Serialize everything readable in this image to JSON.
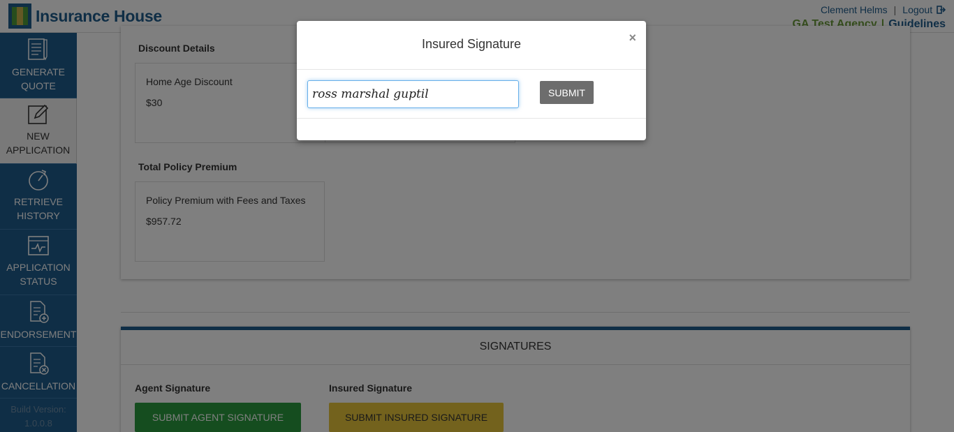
{
  "header": {
    "brand": "Insurance House",
    "user_name": "Clement Helms",
    "logout_label": "Logout",
    "agency": "GA Test Agency",
    "guidelines": "Guidelines"
  },
  "sidebar": {
    "items": [
      {
        "line1": "GENERATE",
        "line2": "QUOTE",
        "icon": "document-list-icon"
      },
      {
        "line1": "NEW",
        "line2": "APPLICATION",
        "icon": "edit-icon"
      },
      {
        "line1": "RETRIEVE",
        "line2": "HISTORY",
        "icon": "history-icon"
      },
      {
        "line1": "APPLICATION",
        "line2": "STATUS",
        "icon": "activity-icon"
      },
      {
        "line1": "ENDORSEMENT",
        "icon": "document-add-icon"
      },
      {
        "line1": "CANCELLATION",
        "icon": "document-cancel-icon"
      }
    ],
    "build_label": "Build Version:",
    "build_version": "1.0.0.8"
  },
  "discount": {
    "title": "Discount Details",
    "label": "Home Age Discount",
    "value": "$30"
  },
  "premium": {
    "title": "Total Policy Premium",
    "label": "Policy Premium with Fees and Taxes",
    "value": "$957.72"
  },
  "signatures": {
    "title": "SIGNATURES",
    "agent_label": "Agent Signature",
    "agent_button": "SUBMIT AGENT SIGNATURE",
    "insured_label": "Insured Signature",
    "insured_button": "SUBMIT INSURED SIGNATURE"
  },
  "modal": {
    "title": "Insured Signature",
    "close": "×",
    "input_value": "ross marshal guptil",
    "submit": "SUBMIT"
  },
  "colors": {
    "brand_blue": "#1f5c8c",
    "brand_green": "#6a9a3a",
    "agent_button": "#2a9a3e",
    "insured_button": "#e6c53a"
  }
}
